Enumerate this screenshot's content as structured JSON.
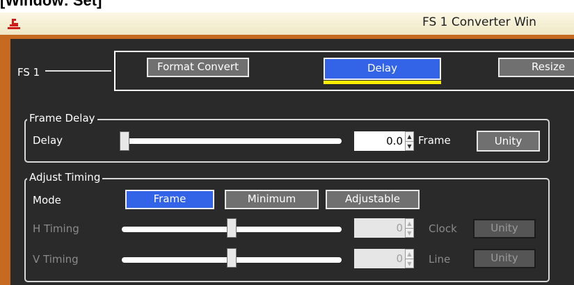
{
  "caption": "[Window: Set]",
  "window": {
    "title": "FS 1 Converter Win"
  },
  "fs_selector": {
    "label": "FS 1",
    "buttons": {
      "format_convert": "Format Convert",
      "delay": "Delay",
      "resize": "Resize"
    },
    "active": "Delay"
  },
  "frame_delay": {
    "group_title": "Frame Delay",
    "delay": {
      "label": "Delay",
      "value": "0.0",
      "unit": "Frame",
      "unity_label": "Unity",
      "slider_position": 0.0
    }
  },
  "adjust_timing": {
    "group_title": "Adjust Timing",
    "mode": {
      "label": "Mode",
      "options": {
        "frame": "Frame",
        "minimum": "Minimum",
        "adjustable": "Adjustable"
      },
      "selected": "Frame"
    },
    "h_timing": {
      "label": "H Timing",
      "value": "0",
      "unit": "Clock",
      "unity_label": "Unity",
      "slider_position": 0.5,
      "enabled": false
    },
    "v_timing": {
      "label": "V Timing",
      "value": "0",
      "unit": "Line",
      "unity_label": "Unity",
      "slider_position": 0.5,
      "enabled": false
    }
  },
  "colors": {
    "window_frame": "#c66a21",
    "panel_background": "#2a2a2a",
    "active_button": "#3364e8",
    "active_tab_indicator": "#ffee00"
  }
}
